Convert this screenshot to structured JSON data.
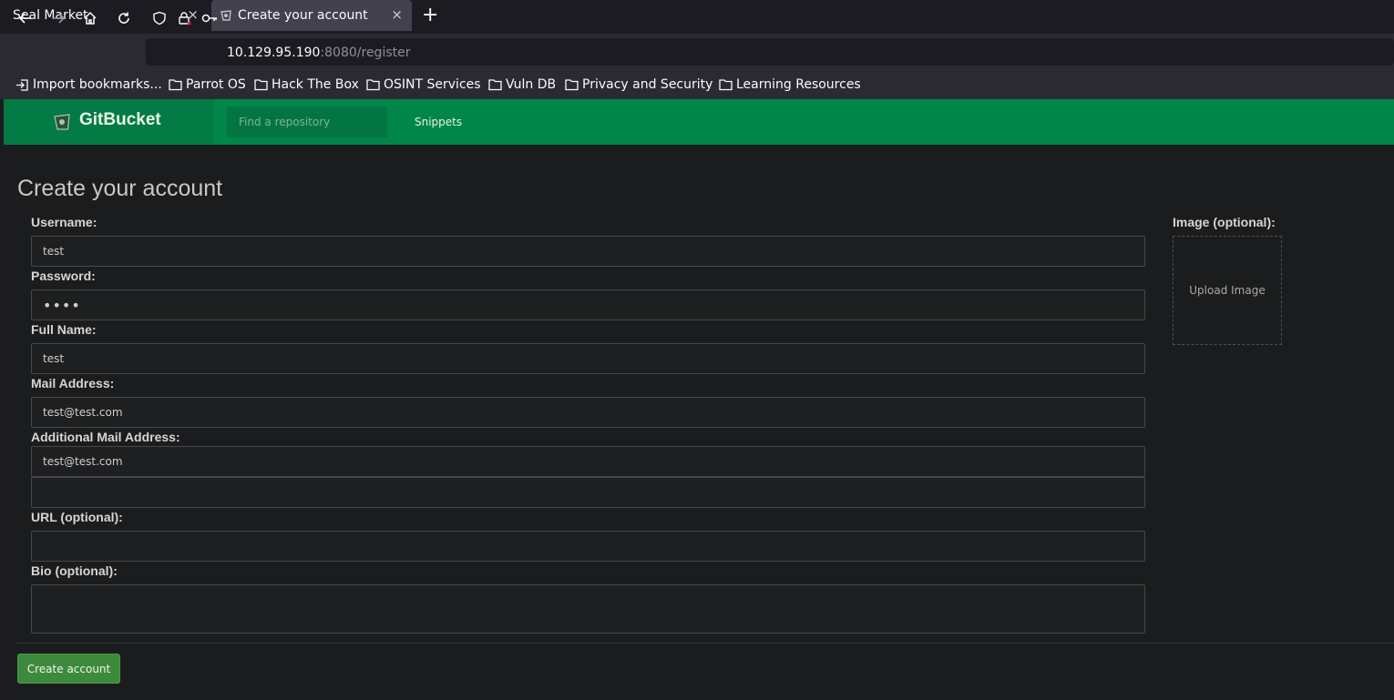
{
  "browser": {
    "tabs": [
      {
        "title": "Seal Market"
      },
      {
        "title": "Create your account"
      }
    ],
    "close_glyph": "×",
    "new_tab_glyph": "+",
    "url_host": "10.129.95.190",
    "url_path": ":8080/register",
    "bookmarks": [
      {
        "label": "Import bookmarks...",
        "icon": "import-icon"
      },
      {
        "label": "Parrot OS",
        "icon": "folder-icon"
      },
      {
        "label": "Hack The Box",
        "icon": "folder-icon"
      },
      {
        "label": "OSINT Services",
        "icon": "folder-icon"
      },
      {
        "label": "Vuln DB",
        "icon": "folder-icon"
      },
      {
        "label": "Privacy and Security",
        "icon": "folder-icon"
      },
      {
        "label": "Learning Resources",
        "icon": "folder-icon"
      }
    ]
  },
  "header": {
    "brand": "GitBucket",
    "search_placeholder": "Find a repository",
    "snippets": "Snippets"
  },
  "form": {
    "title": "Create your account",
    "username_label": "Username:",
    "username_value": "test",
    "password_label": "Password:",
    "password_value": "test",
    "fullname_label": "Full Name:",
    "fullname_value": "test",
    "mail_label": "Mail Address:",
    "mail_value": "test@test.com",
    "extra_mail_label": "Additional Mail Address:",
    "extra_mail_value_1": "test@test.com",
    "extra_mail_value_2": "",
    "url_label": "URL (optional):",
    "url_value": "",
    "bio_label": "Bio (optional):",
    "bio_value": "",
    "image_label": "Image (optional):",
    "upload_label": "Upload Image",
    "submit_label": "Create account"
  },
  "colors": {
    "header_green": "#008649",
    "button_green": "#3d8a3d",
    "background": "#1b1c1d"
  }
}
